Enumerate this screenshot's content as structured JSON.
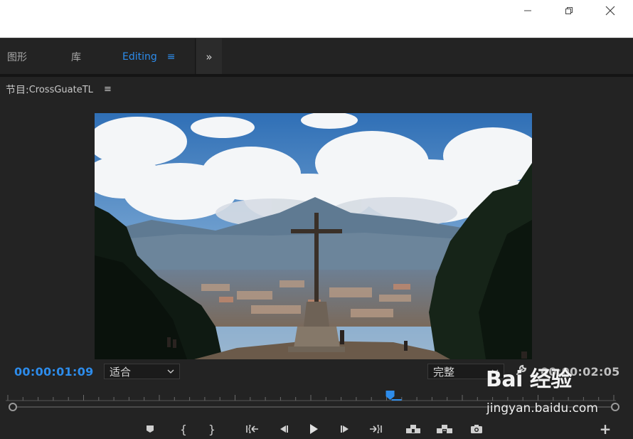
{
  "window": {
    "minimize_icon": "minimize-icon",
    "restore_icon": "restore-icon",
    "close_icon": "close-icon"
  },
  "workspace_tabs": [
    {
      "label": "图形",
      "active": false
    },
    {
      "label": "库",
      "active": false
    },
    {
      "label": "Editing",
      "active": true
    }
  ],
  "accent_color": "#2d8ceb",
  "program_monitor": {
    "title_prefix": "节目:",
    "clip_name": "CrossGuateTL",
    "current_timecode": "00:00:01:09",
    "duration_timecode": "00:00:02:05",
    "zoom_value": "适合",
    "resolution_value": "完整",
    "playhead_fraction": 0.63
  },
  "watermark": {
    "logo_text": "Bai 经验",
    "url": "jingyan.baidu.com"
  }
}
